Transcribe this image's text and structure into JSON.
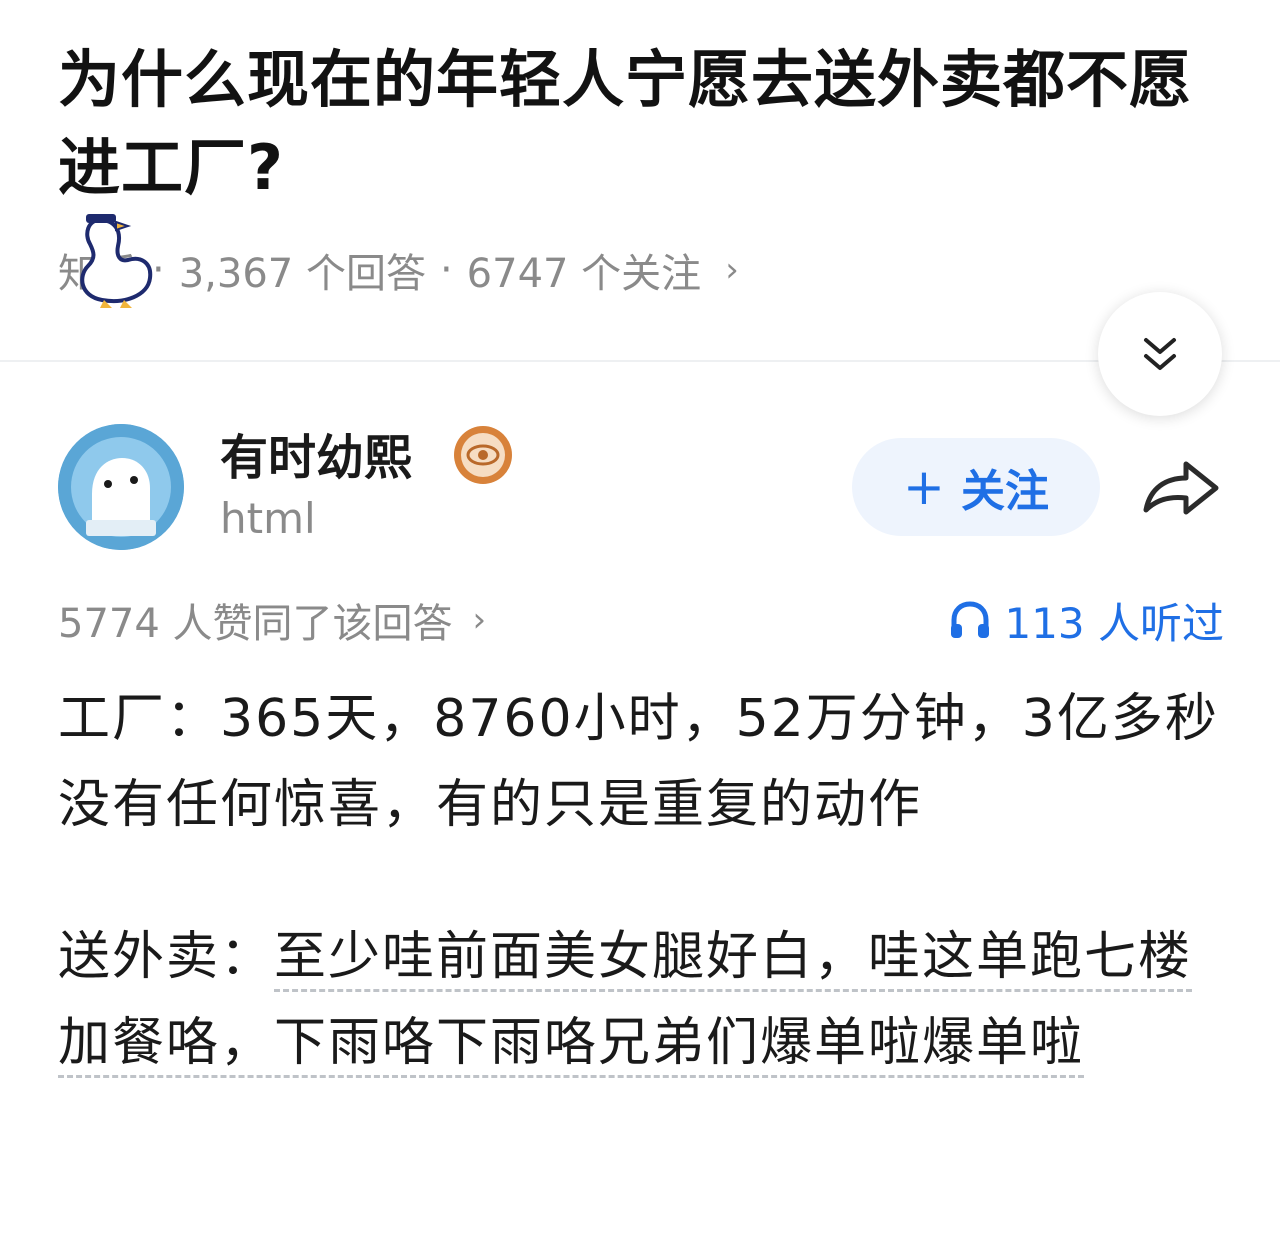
{
  "question": {
    "title": "为什么现在的年轻人宁愿去送外卖都不愿进工厂?",
    "source": "知乎",
    "answers": "3,367 个回答",
    "followers": "6747 个关注",
    "separator": "·",
    "chevron": "›"
  },
  "answer": {
    "author_name": "有时幼熙",
    "author_bio": "html",
    "follow_label": "关注",
    "follow_plus": "+",
    "upvotes": "5774 人赞同了该回答",
    "upvotes_chevron": "›",
    "listens": "113 人听过",
    "paragraph1": "工厂：365天，8760小时，52万分钟，3亿多秒没有任何惊喜，有的只是重复的动作",
    "paragraph2_label": "送外卖：",
    "paragraph2_text": "至少哇前面美女腿好白，哇这单跑七楼加餐咯，下雨咯下雨咯兄弟们爆单啦爆单啦"
  },
  "icons": {
    "collapse": "double-chevron-down-icon",
    "share": "share-arrow-icon",
    "headphones": "headphones-icon",
    "badge": "eye-badge-icon",
    "sticker": "duck-sticker"
  },
  "colors": {
    "accent": "#1f6fe5",
    "follow_bg": "#eef4fd",
    "muted": "#8a8a8a",
    "badge": "#d8823a"
  }
}
